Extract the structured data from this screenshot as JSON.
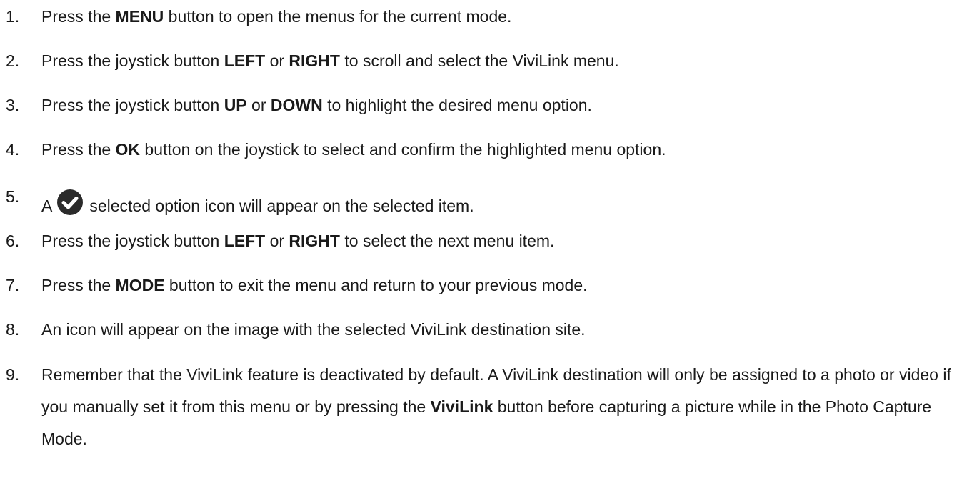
{
  "steps": [
    {
      "num": "1.",
      "p1": "Press the ",
      "b1": "MENU",
      "p2": " button to open the menus for the current mode."
    },
    {
      "num": "2.",
      "p1": "Press the joystick button ",
      "b1": "LEFT",
      "p2": " or ",
      "b2": "RIGHT",
      "p3": " to scroll and select the ViviLink menu."
    },
    {
      "num": "3.",
      "p1": "Press the joystick button ",
      "b1": "UP",
      "p2": " or ",
      "b2": "DOWN",
      "p3": " to highlight the desired menu option."
    },
    {
      "num": "4.",
      "p1": "Press the ",
      "b1": "OK",
      "p2": " button on the joystick to select and confirm the highlighted menu option."
    },
    {
      "num": "5.",
      "p1": "A",
      "p2": "selected option icon will appear on the selected item.",
      "icon": "check-circle-icon"
    },
    {
      "num": "6.",
      "p1": "Press the joystick button ",
      "b1": "LEFT",
      "p2": " or ",
      "b2": "RIGHT",
      "p3": " to select the next menu item."
    },
    {
      "num": "7.",
      "p1": "Press the ",
      "b1": "MODE",
      "p2": " button to exit the menu and return to your previous mode."
    },
    {
      "num": "8.",
      "p1": "An icon will appear on the image with the selected ViviLink destination site."
    },
    {
      "num": "9.",
      "p1": "Remember that the ViviLink feature is deactivated by default. A ViviLink destination will only be assigned to a photo or video if you manually set it from this menu or by pressing the ",
      "b1": "ViviLink",
      "p2": " button before capturing a picture while in the Photo Capture Mode."
    }
  ],
  "colors": {
    "text": "#1a1a1a",
    "icon_fill": "#2b2b2b",
    "icon_check": "#ffffff"
  }
}
